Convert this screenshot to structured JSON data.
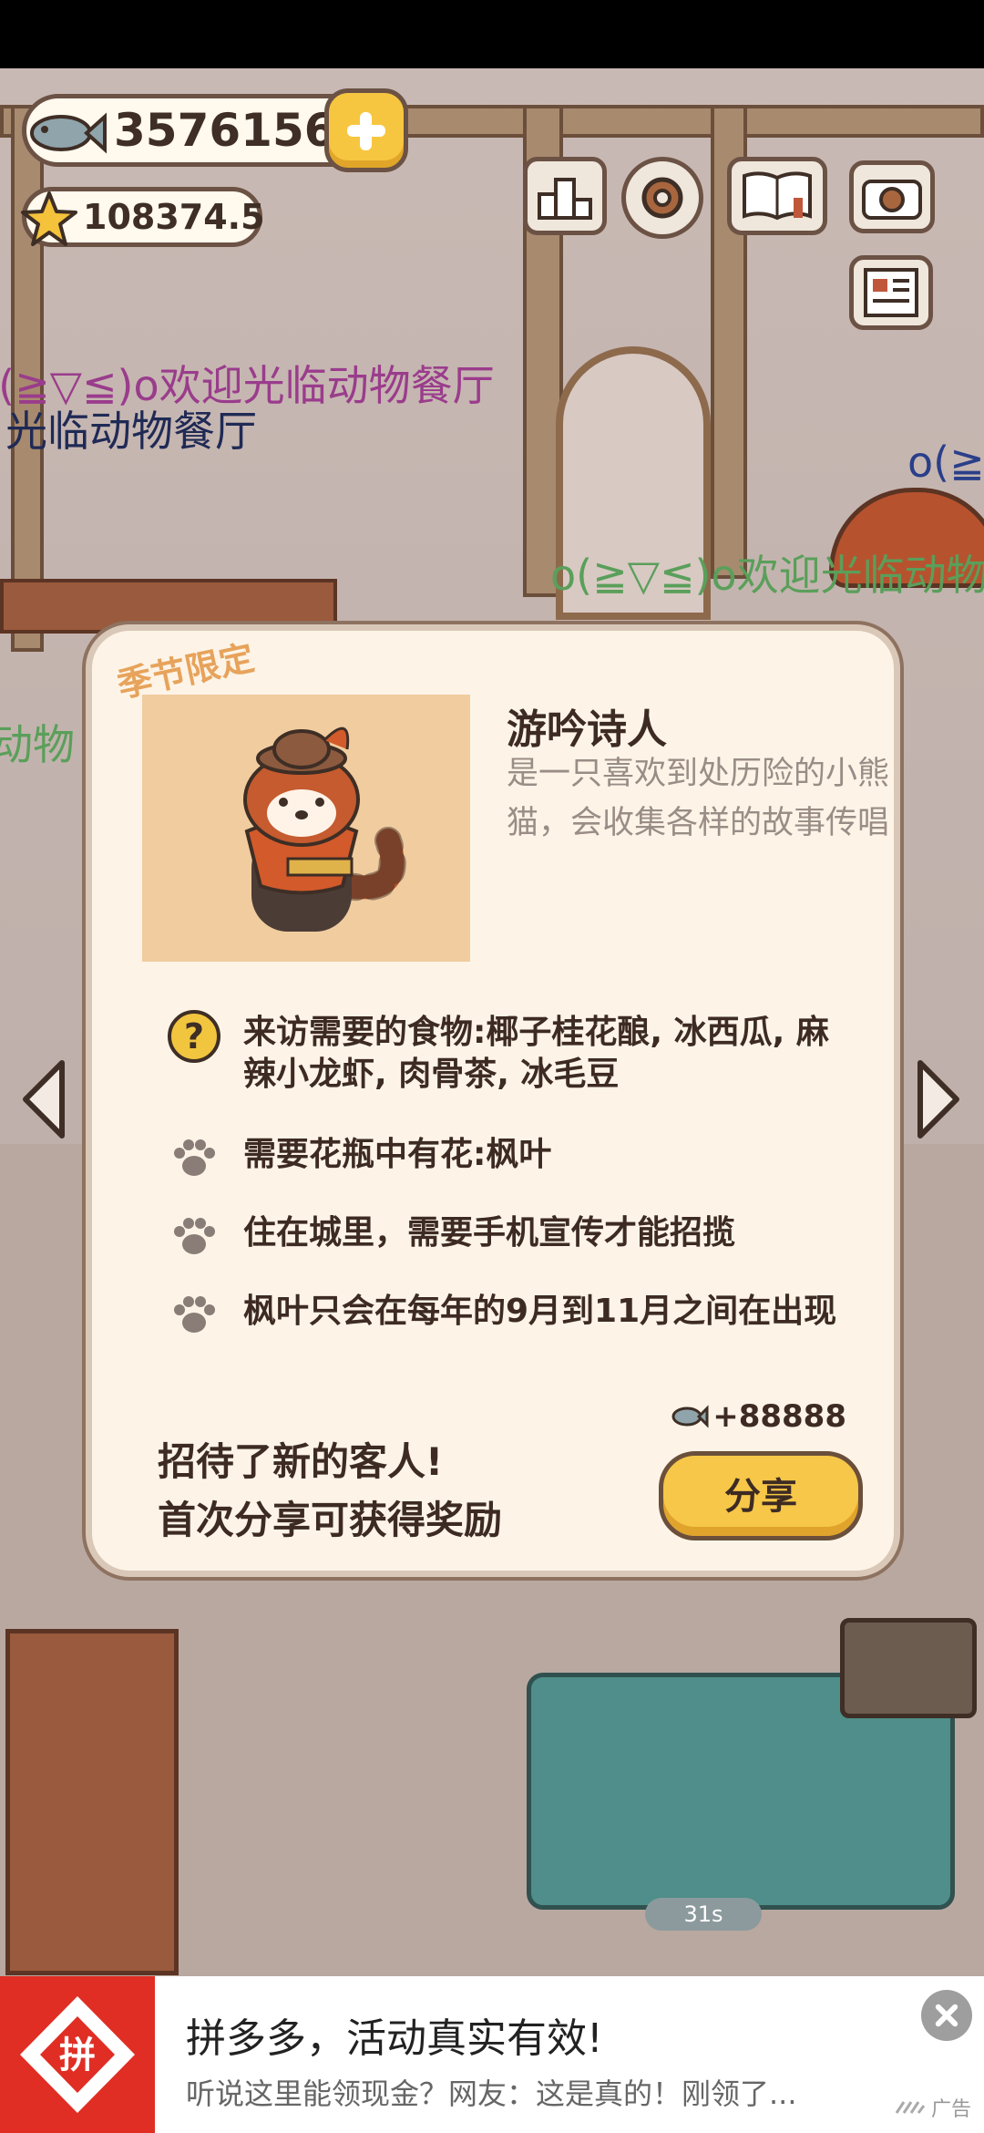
{
  "hud": {
    "fish_coins": "3576156",
    "star_points": "108374.5"
  },
  "danmaku": [
    "o(≧▽≦)o欢迎光临动物餐厅",
    "光临动物餐厅",
    "o(≧",
    "o(≧▽≦)o欢迎光临动物餐",
    "动物"
  ],
  "dialog": {
    "season_tag": "季节限定",
    "guest_name": "游吟诗人",
    "guest_description": "是一只喜欢到处历险的小熊猫，会收集各样的故事传唱",
    "requirements": [
      {
        "icon": "help-icon",
        "text": "来访需要的食物:椰子桂花酿, 冰西瓜, 麻辣小龙虾, 肉骨茶, 冰毛豆"
      },
      {
        "icon": "paw-icon",
        "text": "需要花瓶中有花:枫叶"
      },
      {
        "icon": "paw-icon",
        "text": "住在城里，需要手机宣传才能招揽"
      },
      {
        "icon": "paw-icon",
        "text": "枫叶只会在每年的9月到11月之间在出现"
      }
    ],
    "reward": "+88888",
    "greeting_line1": "招待了新的客人!",
    "greeting_line2": "首次分享可获得奖励",
    "share_label": "分享"
  },
  "scene": {
    "timer": "31s"
  },
  "ad": {
    "logo_text": "拼",
    "title": "拼多多，活动真实有效!",
    "subtitle": "听说这里能领现金？网友：这是真的！刚领了...",
    "label": "广告"
  },
  "colors": {
    "dialog_bg": "#fdf4e7",
    "accent_yellow": "#f6c748",
    "season_tag": "#e7a35b",
    "ad_red": "#e02e24"
  }
}
